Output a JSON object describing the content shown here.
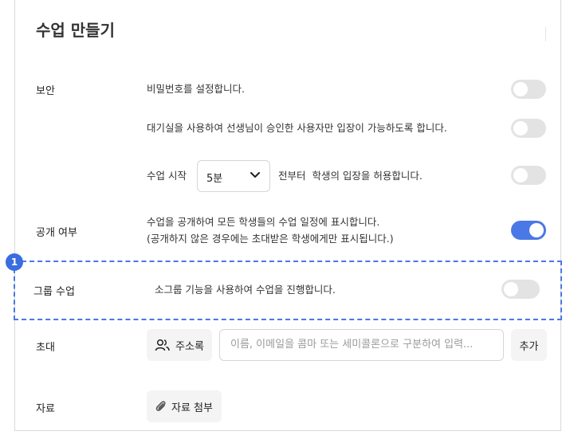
{
  "title": "수업 만들기",
  "security": {
    "label": "보안",
    "rows": [
      {
        "text": "비밀번호를 설정합니다.",
        "enabled": false
      },
      {
        "text": "대기실을 사용하여 선생님이 승인한 사용자만 입장이 가능하도록 합니다.",
        "enabled": false
      },
      {
        "prefix": "수업 시작",
        "select_value": "5분",
        "suffix": "전부터  학생의 입장을 허용합니다.",
        "enabled": false
      }
    ]
  },
  "public": {
    "label": "공개 여부",
    "line1": "수업을 공개하여 모든 학생들의 수업 일정에 표시합니다.",
    "line2": "(공개하지 않은 경우에는 초대받은 학생에게만 표시됩니다.)",
    "enabled": true
  },
  "group": {
    "badge": "1",
    "label": "그룹 수업",
    "text": "소그룹 기능을 사용하여 수업을 진행합니다.",
    "enabled": false
  },
  "invite": {
    "label": "초대",
    "address_book": "주소록",
    "placeholder": "이름, 이메일을 콤마 또는 세미콜론으로 구분하여 입력...",
    "add": "추가"
  },
  "materials": {
    "label": "자료",
    "attach": "자료 첨부"
  },
  "colors": {
    "accent": "#4a78e6",
    "toggle_off": "#e3e3e3"
  }
}
